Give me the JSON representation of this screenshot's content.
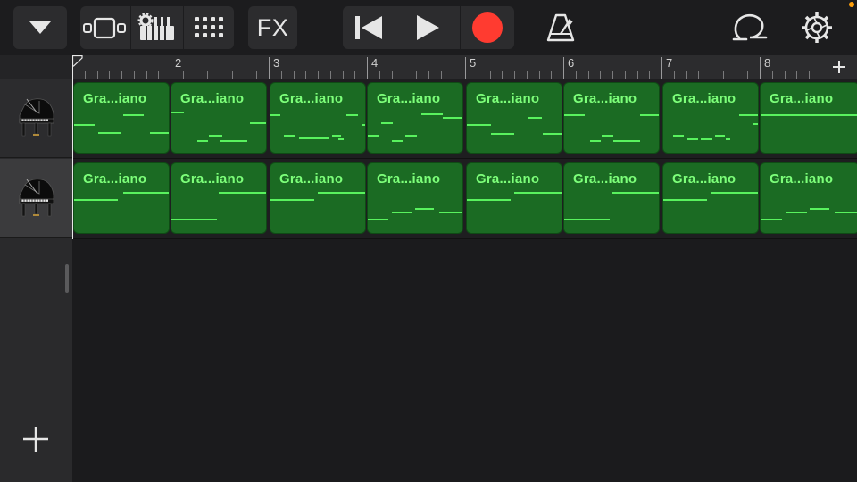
{
  "toolbar": {
    "fx_label": "FX"
  },
  "ruler": {
    "bars": [
      "2",
      "3",
      "4",
      "5",
      "6",
      "7",
      "8"
    ]
  },
  "tracks": [
    {
      "instrument_icon": "grand-piano-icon",
      "regions": [
        {
          "name": "Gra...iano",
          "notes": [
            [
              52,
              35,
              22
            ],
            [
              0,
              46,
              22
            ],
            [
              25,
              55,
              25
            ],
            [
              80,
              55,
              22
            ],
            [
              0,
              0,
              0
            ]
          ]
        },
        {
          "name": "Gra...iano",
          "notes": [
            [
              0,
              32,
              13
            ],
            [
              83,
              44,
              25
            ],
            [
              40,
              58,
              14
            ],
            [
              27,
              64,
              12
            ],
            [
              52,
              64,
              28
            ]
          ]
        },
        {
          "name": "Gra...iano",
          "notes": [
            [
              0,
              35,
              10
            ],
            [
              80,
              35,
              12
            ],
            [
              96,
              46,
              12
            ],
            [
              14,
              58,
              12
            ],
            [
              30,
              61,
              20
            ],
            [
              50,
              61,
              12
            ],
            [
              65,
              58,
              10
            ],
            [
              72,
              62,
              5
            ]
          ]
        },
        {
          "name": "Gra...iano",
          "notes": [
            [
              57,
              34,
              22
            ],
            [
              79,
              38,
              28
            ],
            [
              14,
              44,
              12
            ],
            [
              0,
              58,
              12
            ],
            [
              40,
              58,
              12
            ],
            [
              25,
              64,
              12
            ]
          ]
        },
        {
          "name": "Gra...iano",
          "notes": [
            [
              65,
              38,
              14
            ],
            [
              0,
              46,
              25
            ],
            [
              25,
              56,
              25
            ],
            [
              80,
              56,
              25
            ]
          ]
        },
        {
          "name": "Gra...iano",
          "notes": [
            [
              0,
              35,
              22
            ],
            [
              80,
              35,
              22
            ],
            [
              40,
              58,
              12
            ],
            [
              27,
              64,
              12
            ],
            [
              52,
              64,
              28
            ]
          ]
        },
        {
          "name": "Gra...iano",
          "notes": [
            [
              80,
              35,
              22
            ],
            [
              94,
              45,
              12
            ],
            [
              10,
              58,
              12
            ],
            [
              25,
              62,
              12
            ],
            [
              40,
              62,
              12
            ],
            [
              55,
              58,
              10
            ],
            [
              66,
              62,
              5
            ]
          ]
        },
        {
          "name": "Gra...iano",
          "notes": [
            [
              0,
              35,
              100
            ]
          ]
        }
      ]
    },
    {
      "instrument_icon": "grand-piano-icon",
      "regions": [
        {
          "name": "Gra...iano",
          "notes": [
            [
              52,
              32,
              48
            ],
            [
              0,
              40,
              46
            ]
          ]
        },
        {
          "name": "Gra...iano",
          "notes": [
            [
              50,
              32,
              50
            ],
            [
              0,
              62,
              48
            ]
          ]
        },
        {
          "name": "Gra...iano",
          "notes": [
            [
              0,
              40,
              46
            ],
            [
              50,
              32,
              50
            ]
          ]
        },
        {
          "name": "Gra...iano",
          "notes": [
            [
              0,
              62,
              22
            ],
            [
              25,
              54,
              22
            ],
            [
              50,
              50,
              20
            ],
            [
              75,
              54,
              25
            ]
          ]
        },
        {
          "name": "Gra...iano",
          "notes": [
            [
              0,
              40,
              46
            ],
            [
              50,
              32,
              50
            ]
          ]
        },
        {
          "name": "Gra...iano",
          "notes": [
            [
              0,
              62,
              48
            ],
            [
              50,
              32,
              50
            ]
          ]
        },
        {
          "name": "Gra...iano",
          "notes": [
            [
              0,
              40,
              46
            ],
            [
              50,
              32,
              50
            ]
          ]
        },
        {
          "name": "Gra...iano",
          "notes": [
            [
              0,
              62,
              22
            ],
            [
              25,
              54,
              22
            ],
            [
              50,
              50,
              20
            ],
            [
              75,
              54,
              25
            ]
          ]
        }
      ]
    }
  ],
  "colors": {
    "region": "#1b6b23",
    "note": "#59f25e",
    "record": "#ff3b30"
  }
}
